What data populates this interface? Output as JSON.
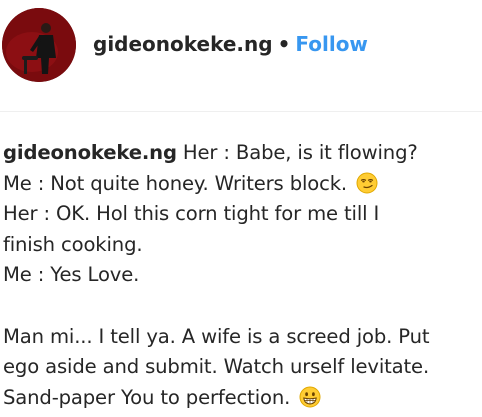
{
  "post": {
    "username": "gideonokeke.ng",
    "separator": "•",
    "follow_label": "Follow"
  },
  "caption": {
    "username": "gideonokeke.ng",
    "lines": [
      " Her : Babe, is it flowing?",
      "Me : Not quite honey. Writers block. ",
      "Her : OK. Hol this corn tight for me till I",
      "finish cooking.",
      "Me : Yes Love.",
      "Man mi... I tell ya. A wife is a screed job. Put",
      "ego aside and submit. Watch urself levitate.",
      "Sand-paper You to perfection. "
    ],
    "emojis": [
      "smirking-face",
      "grinning-face-with-big-eyes"
    ]
  },
  "colors": {
    "follow": "#3897f0",
    "text": "#262626",
    "divider": "#efefef",
    "avatar_bg": "#7a0b0e"
  }
}
